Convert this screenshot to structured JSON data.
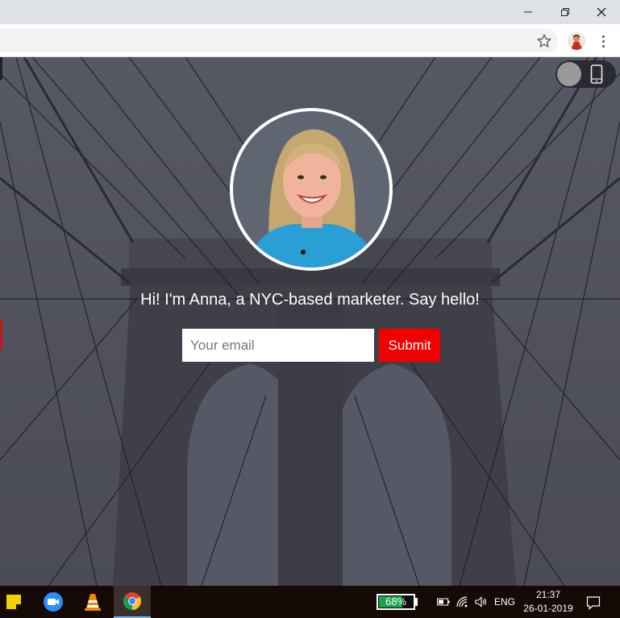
{
  "window_controls": {
    "minimize_icon": "minimize-icon",
    "restore_icon": "restore-icon",
    "close_icon": "close-icon"
  },
  "toolbar": {
    "bookmark_icon": "star-icon",
    "menu_icon": "kebab-menu-icon"
  },
  "device_toggle": {
    "icon": "smartphone-icon"
  },
  "page": {
    "headline": "Hi! I'm Anna, a NYC-based marketer. Say hello!",
    "email_placeholder": "Your email",
    "submit_label": "Submit"
  },
  "colors": {
    "submit_bg": "#f20000",
    "overlay": "#4c4d58",
    "battery_green": "#1aa34a",
    "taskbar": "#150a06"
  },
  "taskbar": {
    "apps": [
      "sticky-notes-icon",
      "zoom-icon",
      "vlc-icon",
      "chrome-icon"
    ],
    "active_app": "chrome-icon",
    "battery_percent": "68%",
    "battery_level": 0.68,
    "language": "ENG",
    "time": "21:37",
    "date": "26-01-2019"
  }
}
